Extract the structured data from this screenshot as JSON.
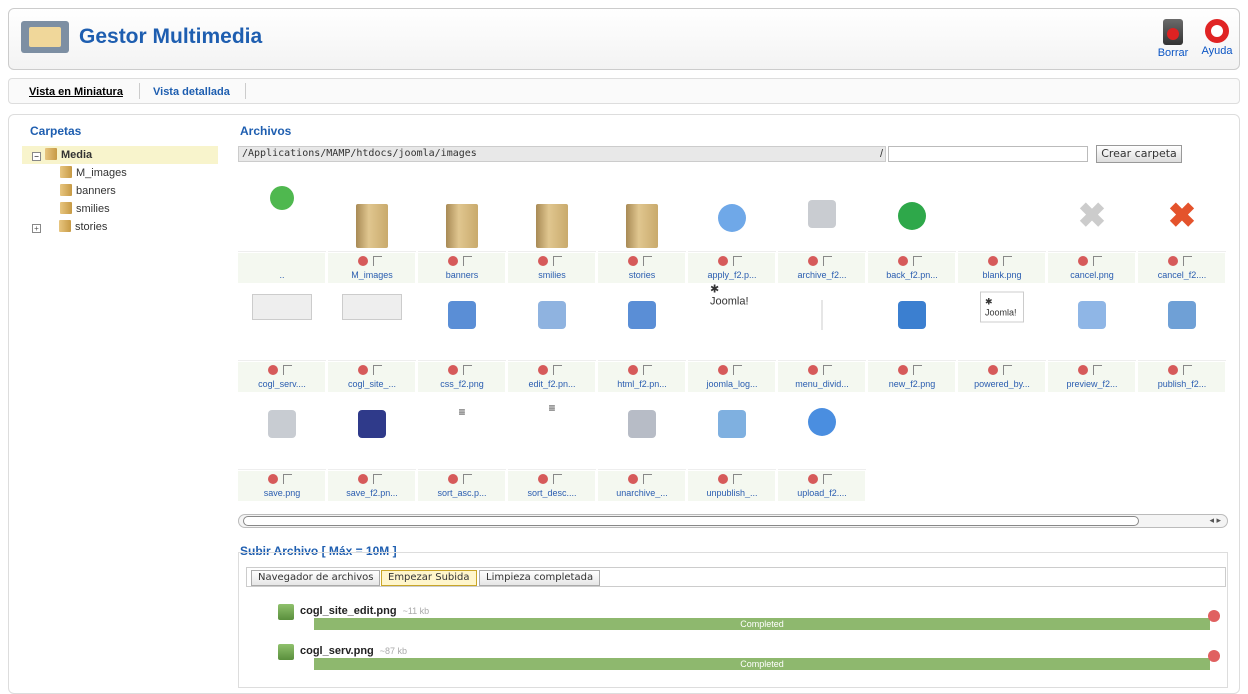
{
  "header": {
    "title": "Gestor Multimedia",
    "toolbar": {
      "delete_label": "Borrar",
      "help_label": "Ayuda"
    }
  },
  "subnav": {
    "tabs": [
      {
        "label": "Vista en Miniatura"
      },
      {
        "label": "Vista detallada"
      }
    ]
  },
  "folders": {
    "legend": "Carpetas",
    "tree": [
      {
        "label": "Media"
      },
      {
        "label": "M_images"
      },
      {
        "label": "banners"
      },
      {
        "label": "smilies"
      },
      {
        "label": "stories"
      }
    ]
  },
  "files": {
    "legend": "Archivos",
    "path": "/Applications/MAMP/htdocs/joomla/images",
    "slash": "/",
    "create_folder_label": "Crear carpeta",
    "items": [
      {
        "name": "..",
        "icon": "up-arrow-icon"
      },
      {
        "name": "M_images",
        "icon": "folder-icon"
      },
      {
        "name": "banners",
        "icon": "folder-icon"
      },
      {
        "name": "smilies",
        "icon": "folder-icon"
      },
      {
        "name": "stories",
        "icon": "folder-icon"
      },
      {
        "name": "apply_f2.p...",
        "icon": "checkmark-icon"
      },
      {
        "name": "archive_f2...",
        "icon": "archive-icon"
      },
      {
        "name": "back_f2.pn...",
        "icon": "back-arrow-icon"
      },
      {
        "name": "blank.png",
        "icon": "blank-icon"
      },
      {
        "name": "cancel.png",
        "icon": "cancel-grey-icon"
      },
      {
        "name": "cancel_f2....",
        "icon": "cancel-red-icon"
      },
      {
        "name": "cogl_serv....",
        "icon": "screenshot-icon"
      },
      {
        "name": "cogl_site_...",
        "icon": "screenshot-icon"
      },
      {
        "name": "css_f2.png",
        "icon": "css-icon"
      },
      {
        "name": "edit_f2.pn...",
        "icon": "edit-icon"
      },
      {
        "name": "html_f2.pn...",
        "icon": "html-icon"
      },
      {
        "name": "joomla_log...",
        "icon": "joomla-logo-icon"
      },
      {
        "name": "menu_divid...",
        "icon": "divider-icon"
      },
      {
        "name": "new_f2.png",
        "icon": "new-icon"
      },
      {
        "name": "powered_by...",
        "icon": "powered-by-icon"
      },
      {
        "name": "preview_f2...",
        "icon": "preview-icon"
      },
      {
        "name": "publish_f2...",
        "icon": "publish-icon"
      },
      {
        "name": "save.png",
        "icon": "save-grey-icon"
      },
      {
        "name": "save_f2.pn...",
        "icon": "save-icon"
      },
      {
        "name": "sort_asc.p...",
        "icon": "sort-asc-icon"
      },
      {
        "name": "sort_desc....",
        "icon": "sort-desc-icon"
      },
      {
        "name": "unarchive_...",
        "icon": "unarchive-icon"
      },
      {
        "name": "unpublish_...",
        "icon": "unpublish-icon"
      },
      {
        "name": "upload_f2....",
        "icon": "upload-icon"
      }
    ],
    "joomla_text": "Joomla!",
    "scroll_arrows": "◂ ▸"
  },
  "upload": {
    "legend": "Subir Archivo [ Máx = 10M ]",
    "buttons": [
      {
        "label": "Navegador de archivos"
      },
      {
        "label": "Empezar Subida"
      },
      {
        "label": "Limpieza completada"
      }
    ],
    "items": [
      {
        "name": "cogl_site_edit.png",
        "size": "~11 kb",
        "status": "Completed",
        "progress": 1
      },
      {
        "name": "cogl_serv.png",
        "size": "~87 kb",
        "status": "Completed",
        "progress": 1
      }
    ]
  },
  "colors": {
    "accent": "#1e5eb0",
    "progress": "#8eb86e",
    "delete": "#d65a5a"
  }
}
